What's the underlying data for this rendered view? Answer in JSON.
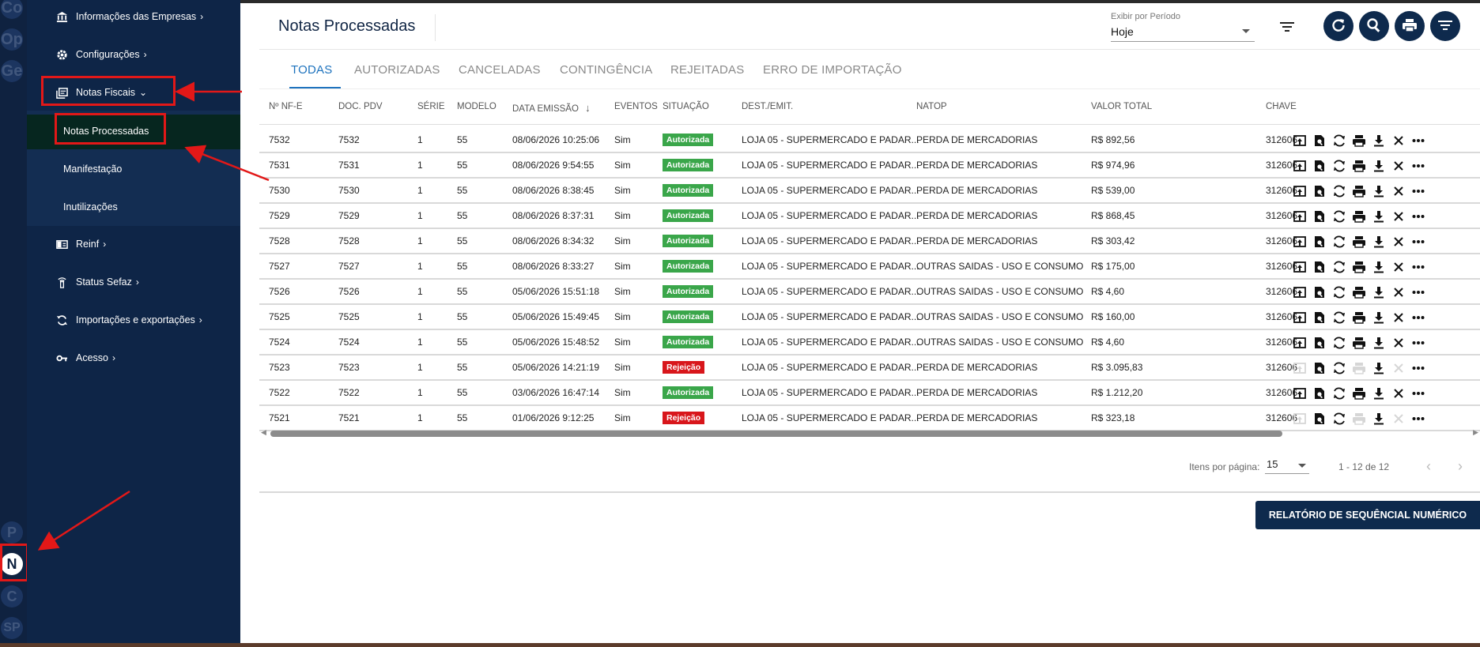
{
  "rail": {
    "avatars_top": [
      "Co",
      "Op",
      "Ge"
    ],
    "avatars_bottom": [
      "P",
      "N",
      "C",
      "SP"
    ]
  },
  "sidebar": {
    "items": [
      {
        "label": "Informações das Empresas",
        "icon": "bank-icon"
      },
      {
        "label": "Configurações",
        "icon": "gear-icon"
      },
      {
        "label": "Notas Fiscais",
        "icon": "documents-icon"
      },
      {
        "label": "Reinf",
        "icon": "book-icon"
      },
      {
        "label": "Status Sefaz",
        "icon": "tower-icon"
      },
      {
        "label": "Importações e exportações",
        "icon": "sync-icon"
      },
      {
        "label": "Acesso",
        "icon": "key-icon"
      }
    ],
    "sub_items": [
      "Notas Processadas",
      "Manifestação",
      "Inutilizações"
    ]
  },
  "header": {
    "title": "Notas Processadas",
    "period_label": "Exibir por Período",
    "period_value": "Hoje"
  },
  "tabs": [
    "TODAS",
    "AUTORIZADAS",
    "CANCELADAS",
    "CONTINGÊNCIA",
    "REJEITADAS",
    "ERRO DE IMPORTAÇÃO"
  ],
  "table": {
    "columns": [
      "Nº NF-E",
      "DOC. PDV",
      "SÉRIE",
      "MODELO",
      "DATA EMISSÃO",
      "EVENTOS",
      "SITUAÇÃO",
      "DEST./EMIT.",
      "NATOP",
      "VALOR TOTAL",
      "CHAVE"
    ],
    "sort_indicator": "↓",
    "rows": [
      {
        "nf": "7532",
        "pdv": "7532",
        "serie": "1",
        "modelo": "55",
        "data": "08/06/2026 10:25:06",
        "eventos": "Sim",
        "situacao": "Autorizada",
        "dest": "LOJA 05 - SUPERMERCADO E PADAR...",
        "natop": "PERDA DE MERCADORIAS",
        "valor": "R$ 892,56",
        "chave": "312606"
      },
      {
        "nf": "7531",
        "pdv": "7531",
        "serie": "1",
        "modelo": "55",
        "data": "08/06/2026 9:54:55",
        "eventos": "Sim",
        "situacao": "Autorizada",
        "dest": "LOJA 05 - SUPERMERCADO E PADAR...",
        "natop": "PERDA DE MERCADORIAS",
        "valor": "R$ 974,96",
        "chave": "312606"
      },
      {
        "nf": "7530",
        "pdv": "7530",
        "serie": "1",
        "modelo": "55",
        "data": "08/06/2026 8:38:45",
        "eventos": "Sim",
        "situacao": "Autorizada",
        "dest": "LOJA 05 - SUPERMERCADO E PADAR...",
        "natop": "PERDA DE MERCADORIAS",
        "valor": "R$ 539,00",
        "chave": "312606"
      },
      {
        "nf": "7529",
        "pdv": "7529",
        "serie": "1",
        "modelo": "55",
        "data": "08/06/2026 8:37:31",
        "eventos": "Sim",
        "situacao": "Autorizada",
        "dest": "LOJA 05 - SUPERMERCADO E PADAR...",
        "natop": "PERDA DE MERCADORIAS",
        "valor": "R$ 868,45",
        "chave": "312606"
      },
      {
        "nf": "7528",
        "pdv": "7528",
        "serie": "1",
        "modelo": "55",
        "data": "08/06/2026 8:34:32",
        "eventos": "Sim",
        "situacao": "Autorizada",
        "dest": "LOJA 05 - SUPERMERCADO E PADAR...",
        "natop": "PERDA DE MERCADORIAS",
        "valor": "R$ 303,42",
        "chave": "312606"
      },
      {
        "nf": "7527",
        "pdv": "7527",
        "serie": "1",
        "modelo": "55",
        "data": "08/06/2026 8:33:27",
        "eventos": "Sim",
        "situacao": "Autorizada",
        "dest": "LOJA 05 - SUPERMERCADO E PADAR...",
        "natop": "OUTRAS SAIDAS - USO E CONSUMO",
        "valor": "R$ 175,00",
        "chave": "312606"
      },
      {
        "nf": "7526",
        "pdv": "7526",
        "serie": "1",
        "modelo": "55",
        "data": "05/06/2026 15:51:18",
        "eventos": "Sim",
        "situacao": "Autorizada",
        "dest": "LOJA 05 - SUPERMERCADO E PADAR...",
        "natop": "OUTRAS SAIDAS - USO E CONSUMO",
        "valor": "R$ 4,60",
        "chave": "312606"
      },
      {
        "nf": "7525",
        "pdv": "7525",
        "serie": "1",
        "modelo": "55",
        "data": "05/06/2026 15:49:45",
        "eventos": "Sim",
        "situacao": "Autorizada",
        "dest": "LOJA 05 - SUPERMERCADO E PADAR...",
        "natop": "OUTRAS SAIDAS - USO E CONSUMO",
        "valor": "R$ 160,00",
        "chave": "312606"
      },
      {
        "nf": "7524",
        "pdv": "7524",
        "serie": "1",
        "modelo": "55",
        "data": "05/06/2026 15:48:52",
        "eventos": "Sim",
        "situacao": "Autorizada",
        "dest": "LOJA 05 - SUPERMERCADO E PADAR...",
        "natop": "OUTRAS SAIDAS - USO E CONSUMO",
        "valor": "R$ 4,60",
        "chave": "312606"
      },
      {
        "nf": "7523",
        "pdv": "7523",
        "serie": "1",
        "modelo": "55",
        "data": "05/06/2026 14:21:19",
        "eventos": "Sim",
        "situacao": "Rejeição",
        "dest": "LOJA 05 - SUPERMERCADO E PADAR...",
        "natop": "PERDA DE MERCADORIAS",
        "valor": "R$ 3.095,83",
        "chave": "312606"
      },
      {
        "nf": "7522",
        "pdv": "7522",
        "serie": "1",
        "modelo": "55",
        "data": "03/06/2026 16:47:14",
        "eventos": "Sim",
        "situacao": "Autorizada",
        "dest": "LOJA 05 - SUPERMERCADO E PADAR...",
        "natop": "PERDA DE MERCADORIAS",
        "valor": "R$ 1.212,20",
        "chave": "312606"
      },
      {
        "nf": "7521",
        "pdv": "7521",
        "serie": "1",
        "modelo": "55",
        "data": "01/06/2026 9:12:25",
        "eventos": "Sim",
        "situacao": "Rejeição",
        "dest": "LOJA 05 - SUPERMERCADO E PADAR...",
        "natop": "PERDA DE MERCADORIAS",
        "valor": "R$ 323,18",
        "chave": "312606"
      }
    ],
    "actions": [
      "upload-icon",
      "view-icon",
      "sync-icon",
      "print-icon",
      "download-icon",
      "close-icon",
      "more-icon"
    ]
  },
  "paginator": {
    "items_label": "Itens por página:",
    "items_value": "15",
    "range": "1 - 12 de 12"
  },
  "report_button": "RELATÓRIO DE SEQUÊNCIAL NUMÉRICO",
  "colors": {
    "sidebar": "#0e2547",
    "accent": "#1e73be",
    "success": "#3aa64a",
    "danger": "#d8161b",
    "annotation": "#e21818"
  }
}
